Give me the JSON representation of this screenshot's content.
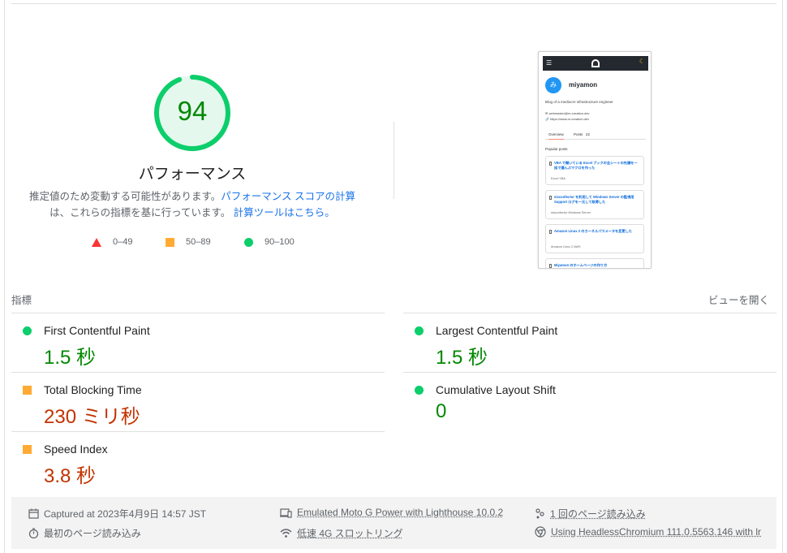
{
  "performance": {
    "score": "94",
    "score_fraction": 0.94,
    "title": "パフォーマンス",
    "desc_text1": "推定値のため変動する可能性があります。",
    "desc_link1": "パフォーマンス スコアの計算",
    "desc_text2": "は、これらの指標を基に行っています。",
    "desc_link2": "計算ツールはこちら。",
    "colors": {
      "pass": "#0cce6b",
      "pass_text": "#008800",
      "average": "#ffaa33",
      "fail": "#ff3333",
      "fail_text": "#c33300"
    }
  },
  "legend": [
    {
      "range": "0–49",
      "icon": "triangle-icon"
    },
    {
      "range": "50–89",
      "icon": "square-icon"
    },
    {
      "range": "90–100",
      "icon": "circle-icon"
    }
  ],
  "screenshot": {
    "name": "miyamon",
    "avatar_text": "み",
    "bio": "Blog of a mediocre infrastructure engineer",
    "email": "webmaster@m-creation.dev",
    "url": "https://www.m-creation.dev",
    "tabs": [
      "Overview",
      "Posts",
      "22"
    ],
    "popular_label": "Popular posts",
    "cards": [
      {
        "title": "VBA で開いている Excel ブックの全シートの先頭を一括で選んぶマクロを作った",
        "tags": "Excel    VBA"
      },
      {
        "title": "sisconfector を利用して Windows Server の監視用 Support ログを一元して取得した",
        "tags": "sisconfector    Windows Server"
      },
      {
        "title": "Amazon Linux 2 のカーネルパラメータを変更した",
        "tags": "Amazon Linux 2    AWS"
      },
      {
        "title": "Miyamon のホームページの作り方",
        "tags": ""
      }
    ]
  },
  "metrics": {
    "label": "指標",
    "toggle": "ビューを開く",
    "items": [
      {
        "name": "First Contentful Paint",
        "value": "1.5 秒",
        "status": "pass"
      },
      {
        "name": "Largest Contentful Paint",
        "value": "1.5 秒",
        "status": "pass"
      },
      {
        "name": "Total Blocking Time",
        "value": "230 ミリ秒",
        "status": "average"
      },
      {
        "name": "Cumulative Layout Shift",
        "value": "0",
        "status": "pass"
      },
      {
        "name": "Speed Index",
        "value": "3.8 秒",
        "status": "average"
      }
    ]
  },
  "footer": {
    "captured": "Captured at 2023年4月9日 14:57 JST",
    "device": "Emulated Moto G Power with Lighthouse 10.0.2",
    "session": "1 回のページ読み込み",
    "initial_load": "最初のページ読み込み",
    "throttling": "低速 4G スロットリング",
    "browser": "Using HeadlessChromium 111.0.5563.146 with lr"
  }
}
